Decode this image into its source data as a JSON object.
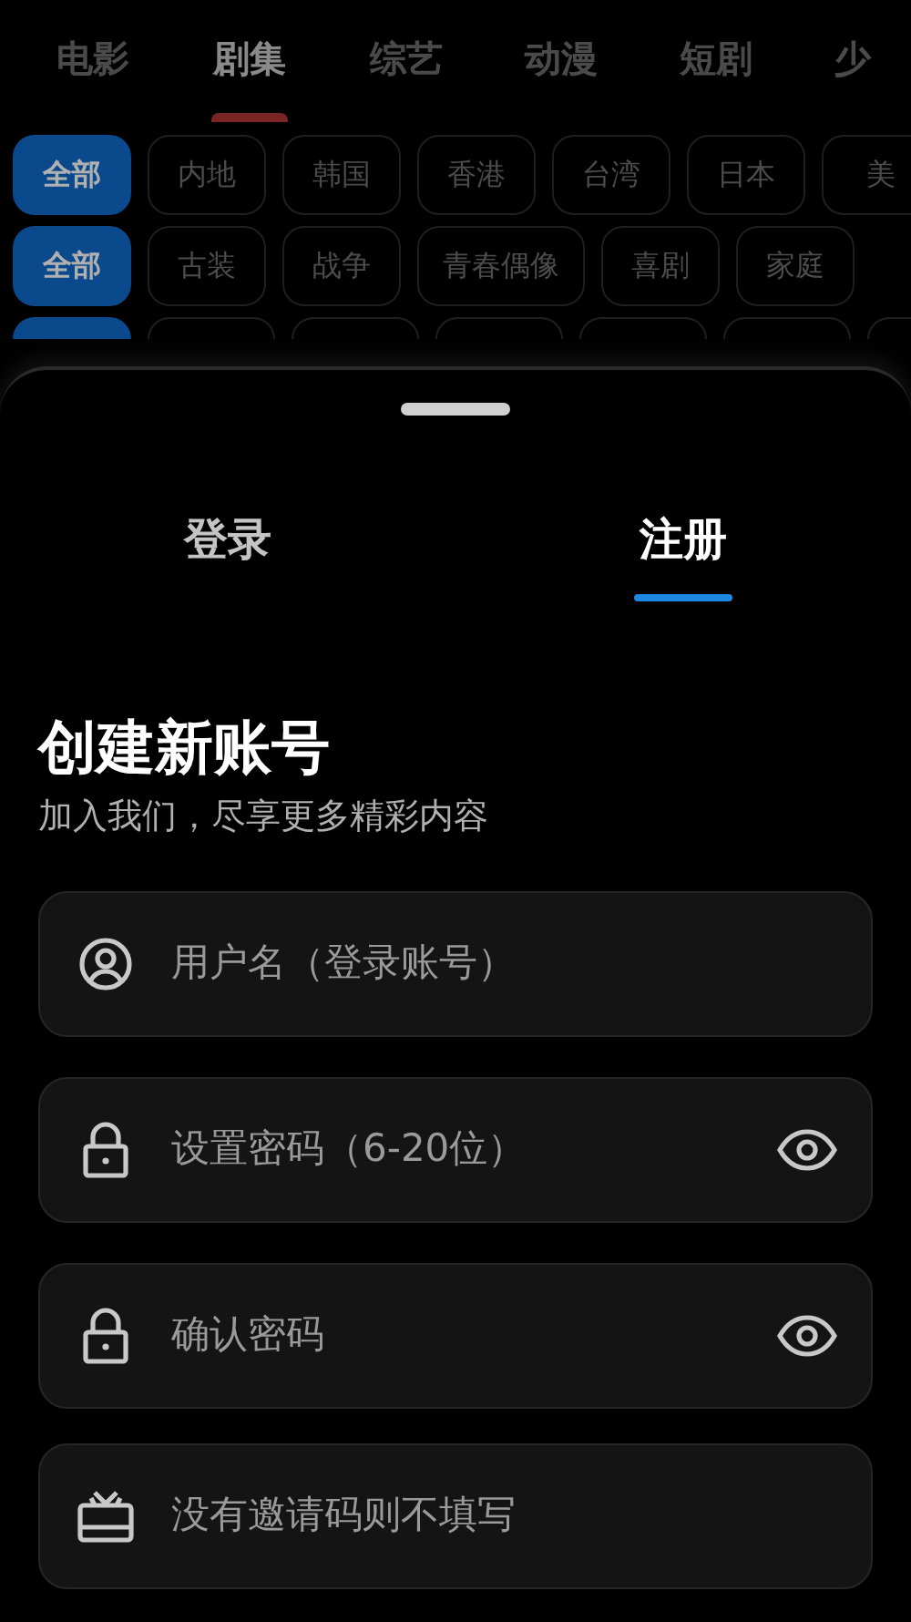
{
  "category_tabs": [
    {
      "label": "电影",
      "selected": false
    },
    {
      "label": "剧集",
      "selected": true
    },
    {
      "label": "综艺",
      "selected": false
    },
    {
      "label": "动漫",
      "selected": false
    },
    {
      "label": "短剧",
      "selected": false
    },
    {
      "label": "少",
      "selected": false
    }
  ],
  "filter_rows": [
    {
      "chips": [
        {
          "label": "全部",
          "selected": true
        },
        {
          "label": "内地",
          "selected": false
        },
        {
          "label": "韩国",
          "selected": false
        },
        {
          "label": "香港",
          "selected": false
        },
        {
          "label": "台湾",
          "selected": false
        },
        {
          "label": "日本",
          "selected": false
        },
        {
          "label": "美",
          "selected": false
        }
      ]
    },
    {
      "chips": [
        {
          "label": "全部",
          "selected": true
        },
        {
          "label": "古装",
          "selected": false
        },
        {
          "label": "战争",
          "selected": false
        },
        {
          "label": "青春偶像",
          "selected": false
        },
        {
          "label": "喜剧",
          "selected": false
        },
        {
          "label": "家庭",
          "selected": false
        }
      ]
    }
  ],
  "sheet": {
    "tabs": [
      {
        "label": "登录",
        "selected": false
      },
      {
        "label": "注册",
        "selected": true
      }
    ],
    "heading": "创建新账号",
    "subtitle": "加入我们，尽享更多精彩内容",
    "fields": [
      {
        "kind": "username",
        "placeholder": "用户名（登录账号）"
      },
      {
        "kind": "password",
        "placeholder": "设置密码（6-20位）"
      },
      {
        "kind": "password",
        "placeholder": "确认密码"
      },
      {
        "kind": "invite",
        "placeholder": "没有邀请码则不填写"
      }
    ]
  }
}
